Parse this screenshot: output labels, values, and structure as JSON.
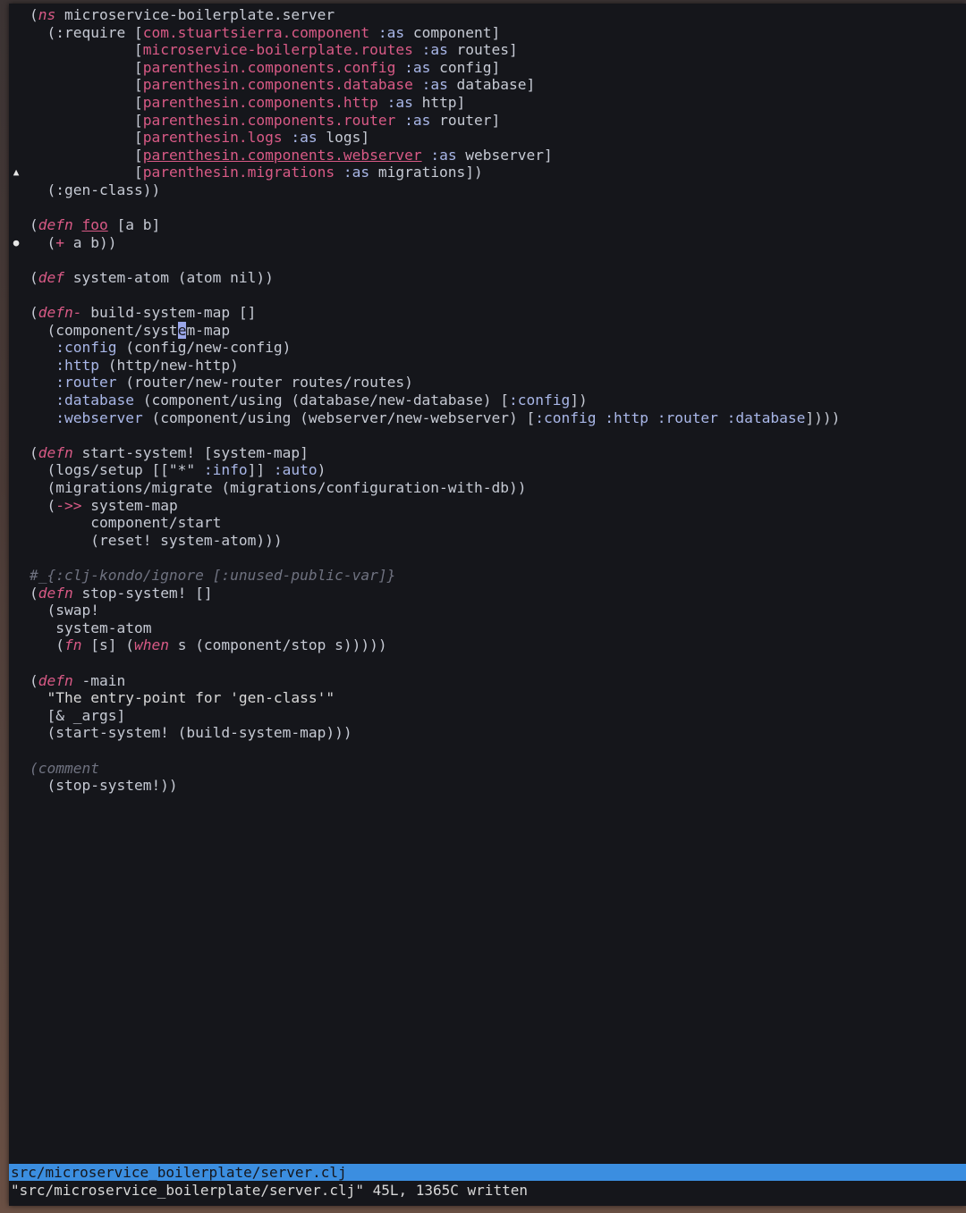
{
  "colors": {
    "background": "#15161b",
    "keyword": "#d95a86",
    "text": "#c6cad4",
    "statusbar": "#3b8ee0"
  },
  "gutter": [
    {
      "line": 9,
      "icon": "warning-icon",
      "glyph": "▲"
    },
    {
      "line": 13,
      "icon": "info-icon",
      "glyph": "●"
    }
  ],
  "code": [
    [
      [
        "p",
        "("
      ],
      [
        "k",
        "ns"
      ],
      [
        "t",
        " microservice-boilerplate.server"
      ]
    ],
    [
      [
        "t",
        "  (:require "
      ],
      [
        "t",
        "["
      ],
      [
        "n",
        "com.stuartsierra.component"
      ],
      [
        "w",
        " :as"
      ],
      [
        "t",
        " component]"
      ]
    ],
    [
      [
        "t",
        "            ["
      ],
      [
        "n",
        "microservice-boilerplate.routes"
      ],
      [
        "w",
        " :as"
      ],
      [
        "t",
        " routes]"
      ]
    ],
    [
      [
        "t",
        "            ["
      ],
      [
        "n",
        "parenthesin.components.config"
      ],
      [
        "w",
        " :as"
      ],
      [
        "t",
        " config]"
      ]
    ],
    [
      [
        "t",
        "            ["
      ],
      [
        "n",
        "parenthesin.components.database"
      ],
      [
        "w",
        " :as"
      ],
      [
        "t",
        " database]"
      ]
    ],
    [
      [
        "t",
        "            ["
      ],
      [
        "n",
        "parenthesin.components.http"
      ],
      [
        "w",
        " :as"
      ],
      [
        "t",
        " http]"
      ]
    ],
    [
      [
        "t",
        "            ["
      ],
      [
        "n",
        "parenthesin.components.router"
      ],
      [
        "w",
        " :as"
      ],
      [
        "t",
        " router]"
      ]
    ],
    [
      [
        "t",
        "            ["
      ],
      [
        "n",
        "parenthesin.logs"
      ],
      [
        "w",
        " :as"
      ],
      [
        "t",
        " logs]"
      ]
    ],
    [
      [
        "t",
        "            ["
      ],
      [
        "u",
        "parenthesin.components.webserver"
      ],
      [
        "w",
        " :as"
      ],
      [
        "t",
        " webserver]"
      ]
    ],
    [
      [
        "t",
        "            ["
      ],
      [
        "n",
        "parenthesin.migrations"
      ],
      [
        "w",
        " :as"
      ],
      [
        "t",
        " migrations])"
      ]
    ],
    [
      [
        "t",
        "  (:gen-class))"
      ]
    ],
    [
      [
        "t",
        ""
      ]
    ],
    [
      [
        "p",
        "("
      ],
      [
        "k",
        "defn"
      ],
      [
        "t",
        " "
      ],
      [
        "u",
        "foo"
      ],
      [
        "t",
        " [a b]"
      ]
    ],
    [
      [
        "t",
        "  ("
      ],
      [
        "o",
        "+"
      ],
      [
        "t",
        " a b))"
      ]
    ],
    [
      [
        "t",
        ""
      ]
    ],
    [
      [
        "p",
        "("
      ],
      [
        "k",
        "def"
      ],
      [
        "t",
        " system-atom (atom nil))"
      ]
    ],
    [
      [
        "t",
        ""
      ]
    ],
    [
      [
        "p",
        "("
      ],
      [
        "k",
        "defn-"
      ],
      [
        "t",
        " build-system-map []"
      ]
    ],
    [
      [
        "t",
        "  (component/syst"
      ],
      [
        "c",
        "e"
      ],
      [
        "t",
        "m-map"
      ]
    ],
    [
      [
        "w",
        "   :config"
      ],
      [
        "t",
        " (config/new-config)"
      ]
    ],
    [
      [
        "w",
        "   :http"
      ],
      [
        "t",
        " (http/new-http)"
      ]
    ],
    [
      [
        "w",
        "   :router"
      ],
      [
        "t",
        " (router/new-router routes/routes)"
      ]
    ],
    [
      [
        "w",
        "   :database"
      ],
      [
        "t",
        " (component/using (database/new-database) ["
      ],
      [
        "w",
        ":config"
      ],
      [
        "t",
        "])"
      ]
    ],
    [
      [
        "w",
        "   :webserver"
      ],
      [
        "t",
        " (component/using (webserver/new-webserver) ["
      ],
      [
        "w",
        ":config :http :router :database"
      ],
      [
        "t",
        "])))"
      ]
    ],
    [
      [
        "t",
        ""
      ]
    ],
    [
      [
        "p",
        "("
      ],
      [
        "k",
        "defn"
      ],
      [
        "t",
        " start-system! [system-map]"
      ]
    ],
    [
      [
        "t",
        "  (logs/setup [[\"*\" "
      ],
      [
        "w",
        ":info"
      ],
      [
        "t",
        "]] "
      ],
      [
        "w",
        ":auto"
      ],
      [
        "t",
        ")"
      ]
    ],
    [
      [
        "t",
        "  (migrations/migrate (migrations/configuration-with-db))"
      ]
    ],
    [
      [
        "t",
        "  ("
      ],
      [
        "o",
        "->>"
      ],
      [
        "t",
        " system-map"
      ]
    ],
    [
      [
        "t",
        "       component/start"
      ]
    ],
    [
      [
        "t",
        "       (reset! system-atom)))"
      ]
    ],
    [
      [
        "t",
        ""
      ]
    ],
    [
      [
        "m",
        "#_{:clj-kondo/ignore [:unused-public-var]}"
      ]
    ],
    [
      [
        "p",
        "("
      ],
      [
        "k",
        "defn"
      ],
      [
        "t",
        " stop-system! []"
      ]
    ],
    [
      [
        "t",
        "  (swap!"
      ]
    ],
    [
      [
        "t",
        "   system-atom"
      ]
    ],
    [
      [
        "t",
        "   ("
      ],
      [
        "k",
        "fn"
      ],
      [
        "t",
        " [s] ("
      ],
      [
        "k",
        "when"
      ],
      [
        "t",
        " s (component/stop s)))))"
      ]
    ],
    [
      [
        "t",
        ""
      ]
    ],
    [
      [
        "p",
        "("
      ],
      [
        "k",
        "defn"
      ],
      [
        "t",
        " -main"
      ]
    ],
    [
      [
        "s",
        "  \"The entry-point for 'gen-class'\""
      ]
    ],
    [
      [
        "t",
        "  [& _args]"
      ]
    ],
    [
      [
        "t",
        "  (start-system! (build-system-map)))"
      ]
    ],
    [
      [
        "t",
        ""
      ]
    ],
    [
      [
        "m",
        "(comment"
      ]
    ],
    [
      [
        "t",
        "  (stop-system!))"
      ]
    ]
  ],
  "statusbar": {
    "filename": "src/microservice_boilerplate/server.clj"
  },
  "message": "\"src/microservice_boilerplate/server.clj\" 45L, 1365C written"
}
